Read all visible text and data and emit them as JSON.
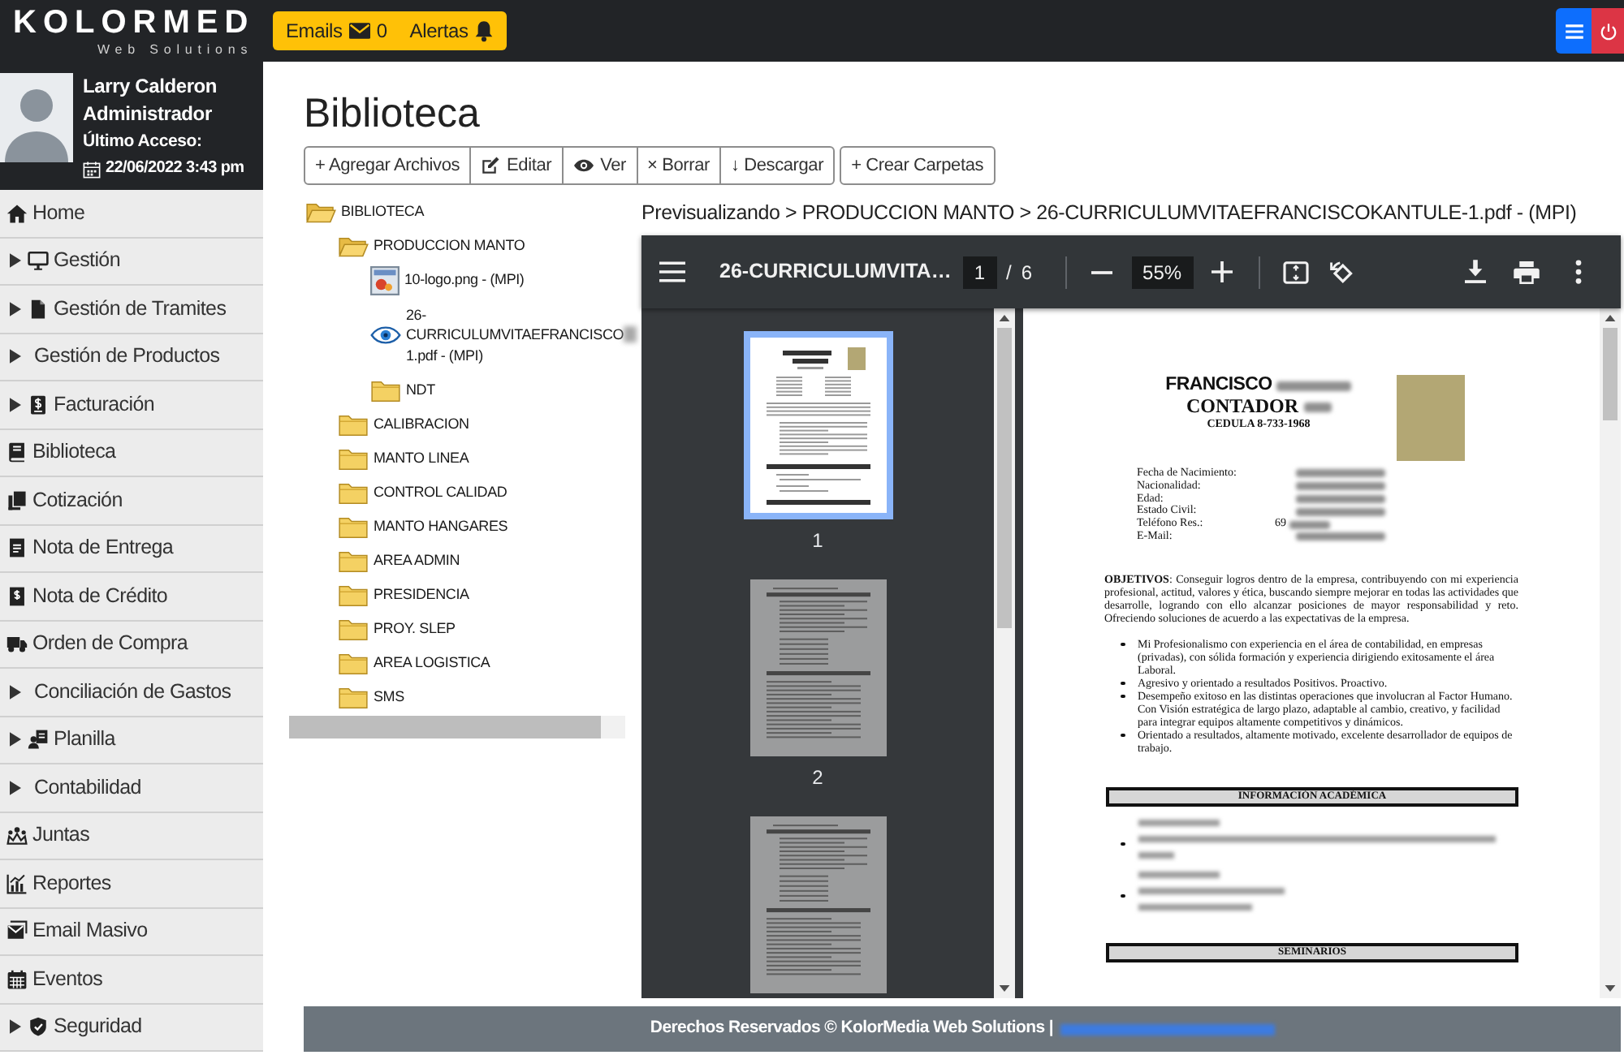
{
  "topbar": {
    "logo": "KOLORMED",
    "tagline": "Web Solutions",
    "notifications": [
      {
        "label": "Emails",
        "count": "0"
      },
      {
        "label": "Alertas"
      }
    ]
  },
  "user": {
    "name": "Larry Calderon",
    "role": "Administrador",
    "last_access_label": "Último Acceso:",
    "last_access": "22/06/2022 3:43 pm"
  },
  "sidebar": {
    "items": [
      {
        "label": "Home",
        "kind": "link"
      },
      {
        "label": "Gestión",
        "kind": "group",
        "expanded": false
      },
      {
        "label": "Gestión de Tramites",
        "kind": "group",
        "expanded": false
      },
      {
        "label": "Gestión de Productos",
        "kind": "group",
        "expanded": false
      },
      {
        "label": "Facturación",
        "kind": "group",
        "expanded": false
      },
      {
        "label": "Biblioteca",
        "kind": "link"
      },
      {
        "label": "Cotización",
        "kind": "link"
      },
      {
        "label": "Nota de Entrega",
        "kind": "link"
      },
      {
        "label": "Nota de Crédito",
        "kind": "link"
      },
      {
        "label": "Orden de Compra",
        "kind": "link"
      },
      {
        "label": "Conciliación de Gastos",
        "kind": "group",
        "expanded": false
      },
      {
        "label": "Planilla",
        "kind": "group",
        "expanded": false
      },
      {
        "label": "Contabilidad",
        "kind": "group",
        "expanded": false
      },
      {
        "label": "Juntas",
        "kind": "link"
      },
      {
        "label": "Reportes",
        "kind": "link"
      },
      {
        "label": "Email Masivo",
        "kind": "link"
      },
      {
        "label": "Eventos",
        "kind": "link"
      },
      {
        "label": "Seguridad",
        "kind": "group",
        "expanded": false
      }
    ]
  },
  "page": {
    "title": "Biblioteca"
  },
  "toolbar": {
    "groups": [
      {
        "buttons": [
          {
            "label": "+ Agregar Archivos"
          },
          {
            "label": "Editar"
          },
          {
            "label": "Ver"
          },
          {
            "label": "× Borrar"
          },
          {
            "label": "↓ Descargar"
          }
        ]
      },
      {
        "buttons": [
          {
            "label": "+ Crear Carpetas"
          }
        ]
      }
    ]
  },
  "tree": [
    {
      "label": "BIBLIOTECA",
      "kind": "folder",
      "expanded": true,
      "children": [
        {
          "label": "PRODUCCION MANTO",
          "kind": "folder",
          "expanded": true,
          "children": [
            {
              "label": "10-logo.png - (MPI)",
              "kind": "file",
              "selected": false
            },
            {
              "label": "26-CURRICULUMVITAEFRANCISCO",
              "label_tail": "1.pdf - (MPI)",
              "kind": "file",
              "selected": true,
              "redacted": true
            },
            {
              "label": "NDT",
              "kind": "folder",
              "expanded": false
            }
          ]
        },
        {
          "label": "CALIBRACION",
          "kind": "folder",
          "expanded": false
        },
        {
          "label": "MANTO LINEA",
          "kind": "folder",
          "expanded": false
        },
        {
          "label": "CONTROL CALIDAD",
          "kind": "folder",
          "expanded": false
        },
        {
          "label": "MANTO HANGARES",
          "kind": "folder",
          "expanded": false
        },
        {
          "label": "AREA ADMIN",
          "kind": "folder",
          "expanded": false
        },
        {
          "label": "PRESIDENCIA",
          "kind": "folder",
          "expanded": false
        },
        {
          "label": "PROY. SLEP",
          "kind": "folder",
          "expanded": false
        },
        {
          "label": "AREA LOGISTICA",
          "kind": "folder",
          "expanded": false
        },
        {
          "label": "SMS",
          "kind": "folder",
          "expanded": false
        }
      ]
    }
  ],
  "preview": {
    "breadcrumb": "Previsualizando > PRODUCCION MANTO > 26-CURRICULUMVITAEFRANCISCOKANTULE-1.pdf - (MPI)"
  },
  "pdf_viewer": {
    "title": "26-CURRICULUMVITA…",
    "page": "1",
    "page_divider": "/",
    "page_count": "6",
    "zoom": "55%",
    "thumbnails": [
      {
        "label": "1",
        "selected": true
      },
      {
        "label": "2",
        "selected": false
      },
      {
        "selected": false
      }
    ],
    "document": {
      "name": "FRANCISCO",
      "name_blurred": true,
      "profession": "CONTADOR",
      "profession_blurred": true,
      "id_line": "CEDULA 8-733-1968",
      "fields": [
        {
          "label": "Fecha de Nacimiento:",
          "blurred": true
        },
        {
          "label": "Nacionalidad:",
          "blurred": true
        },
        {
          "label": "Edad:",
          "blurred": true
        },
        {
          "label": "Estado Civil:",
          "blurred": true
        },
        {
          "label": "Teléfono Res.:",
          "value": "69",
          "blurred": true
        },
        {
          "label": "E-Mail:",
          "blurred": true
        }
      ],
      "objective": "**OBJETIVOS**: Conseguir logros dentro de la empresa, contribuyendo con mi experiencia profesional, actitud, valores y ética, buscando siempre mejorar en todas las actividades que desarrolle, logrando con ello alcanzar posiciones de mayor responsabilidad y reto. Ofreciendo soluciones de acuerdo a las expectativas de la empresa.",
      "bullets": [
        "Mi Profesionalismo con experiencia en el área de contabilidad, en empresas (privadas), con sólida formación y experiencia dirigiendo exitosamente el área Laboral.",
        "Agresivo y orientado a resultados Positivos. Proactivo.",
        "Desempeño exitoso en las distintas operaciones que involucran al Factor Humano. Con Visión estratégica de largo plazo, adaptable al cambio, creativo, y facilidad para integrar equipos altamente competitivos y dinámicos.",
        "Orientado a resultados, altamente motivado, excelente desarrollador de equipos de trabajo."
      ],
      "sections": [
        {
          "heading": "INFORMACIÓN ACADÉMICA",
          "items": [
            {
              "blurred": true
            },
            {
              "blurred": true
            }
          ]
        },
        {
          "heading": "SEMINARIOS"
        }
      ]
    }
  },
  "footer": {
    "text": "Derechos Reservados © KolorMedia Web Solutions |",
    "link_blurred": true
  }
}
